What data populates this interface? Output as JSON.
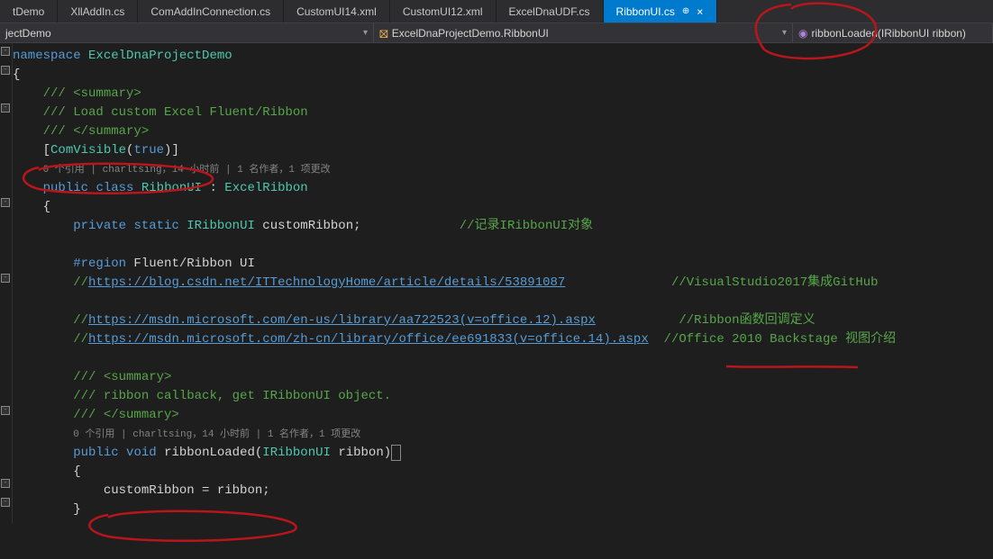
{
  "tabs": [
    {
      "label": "tDemo"
    },
    {
      "label": "XllAddIn.cs"
    },
    {
      "label": "ComAddInConnection.cs"
    },
    {
      "label": "CustomUI14.xml"
    },
    {
      "label": "CustomUI12.xml"
    },
    {
      "label": "ExcelDnaUDF.cs"
    },
    {
      "label": "RibbonUI.cs",
      "active": true
    }
  ],
  "close_glyph": "×",
  "pin_glyph": "⊕",
  "breadcrumb": {
    "project": "jectDemo",
    "class": "ExcelDnaProjectDemo.RibbonUI",
    "method": "ribbonLoaded(IRibbonUI ribbon)"
  },
  "arrow_glyph": "▾",
  "code": {
    "ns": "namespace",
    "nsname": "ExcelDnaProjectDemo",
    "sum_open": "/// <summary>",
    "sum_line1": "/// Load custom Excel Fluent/Ribbon",
    "sum_close": "/// </summary>",
    "attr_open": "[",
    "attr_name": "ComVisible",
    "attr_paren_open": "(",
    "attr_val": "true",
    "attr_paren_close": ")",
    "attr_close": "]",
    "codelens1": "0 个引用 | charltsing，14 小时前 | 1 名作者，1 项更改",
    "public": "public",
    "class_kw": "class",
    "cls_name": "RibbonUI",
    "colon": " : ",
    "base": "ExcelRibbon",
    "private": "private",
    "static": "static",
    "itype": "IRibbonUI",
    "field": " customRibbon;",
    "cmt_field": "//记录IRibbonUI对象",
    "region": "#region",
    "region_name": " Fluent/Ribbon UI",
    "slashes": "//",
    "url1": "https://blog.csdn.net/ITTechnologyHome/article/details/53891087",
    "url1_cmt": "//VisualStudio2017集成GitHub",
    "url2": "https://msdn.microsoft.com/en-us/library/aa722523(v=office.12).aspx",
    "url2_cmt": "//Ribbon函数回调定义",
    "url3": "https://msdn.microsoft.com/zh-cn/library/office/ee691833(v=office.14).aspx",
    "url3_cmt": "//Office 2010 Backstage 视图介绍",
    "sum2_open": "/// <summary>",
    "sum2_line": "/// ribbon callback, get IRibbonUI object.",
    "sum2_close": "/// </summary>",
    "codelens2": "0 个引用 | charltsing，14 小时前 | 1 名作者，1 项更改",
    "void": "void",
    "method": "ribbonLoaded",
    "paren_open": "(",
    "param_type": "IRibbonUI",
    "param_name": " ribbon",
    "paren_close": ")",
    "body": "customRibbon = ribbon;"
  }
}
